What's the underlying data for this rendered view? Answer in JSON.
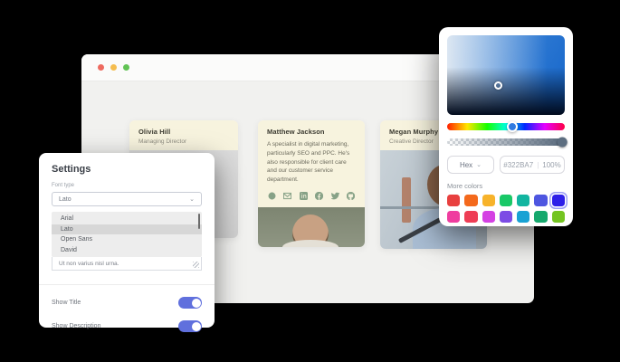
{
  "window": {
    "titlebar_buttons": [
      "close",
      "minimize",
      "maximize"
    ],
    "cards": [
      {
        "name": "Olivia Hill",
        "role": "Managing Director",
        "description": ""
      },
      {
        "name": "Matthew Jackson",
        "role": "",
        "description": "A specialist in digital marketing, particularly SEO and PPC. He's also responsible for client care and our customer service department.",
        "social_icons": [
          "website-globe",
          "email",
          "linkedin",
          "facebook",
          "twitter",
          "github"
        ]
      },
      {
        "name": "Megan Murphy",
        "role": "Creative Director",
        "description": ""
      }
    ]
  },
  "settings_panel": {
    "title": "Settings",
    "font_type_label": "Font type",
    "font_select_value": "Lato",
    "font_options": [
      "Arial",
      "Lato",
      "Open Sans",
      "David"
    ],
    "selected_option": "Lato",
    "textarea_value": "Ut non varius nisl urna.",
    "toggles": [
      {
        "label": "Show Title",
        "on": true
      },
      {
        "label": "Show Description",
        "on": true
      }
    ]
  },
  "color_picker": {
    "mode_label": "Hex",
    "hex_value": "#322BA7",
    "divider": "|",
    "opacity_value": "100%",
    "more_colors_label": "More colors",
    "swatches": {
      "row1": [
        "#e8403f",
        "#f4691c",
        "#f7b32b",
        "#19c867",
        "#12b5a0",
        "#4e56e0",
        "#2d1fe8"
      ],
      "row2": [
        "#ef3d9f",
        "#ee3d55",
        "#d441e3",
        "#7c4ce5",
        "#18a2d4",
        "#16a86d",
        "#74c421"
      ],
      "selected": "#2d1fe8"
    }
  },
  "colors": {
    "toggle_on": "#6070dd",
    "card_background": "#f7f3de",
    "social_icon": "#87a287",
    "window_background": "#f1f1ef",
    "traffic_red": "#ee6a5f",
    "traffic_yellow": "#f5bd4f",
    "traffic_green": "#61c354"
  }
}
